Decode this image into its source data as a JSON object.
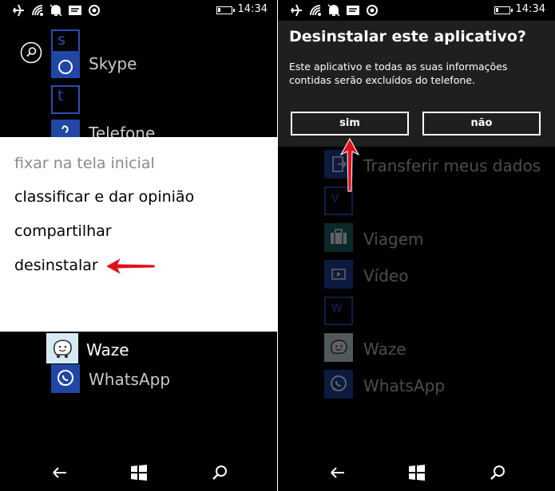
{
  "left_screen": {
    "status": {
      "time": "14:34"
    },
    "apps": {
      "s_letter": "s",
      "skype": "Skype",
      "t_letter": "t",
      "telefone": "Telefone",
      "waze": "Waze",
      "whatsapp": "WhatsApp"
    },
    "context_menu": {
      "items": [
        {
          "label": "fixar na tela inicial",
          "enabled": false
        },
        {
          "label": "classificar e dar opinião",
          "enabled": true
        },
        {
          "label": "compartilhar",
          "enabled": true
        },
        {
          "label": "desinstalar",
          "enabled": true
        }
      ]
    }
  },
  "right_screen": {
    "status": {
      "time": "14:34"
    },
    "dialog": {
      "title": "Desinstalar este aplicativo?",
      "message": "Este aplicativo e todas as suas informações contidas serão excluídos do telefone.",
      "yes_label": "sim",
      "no_label": "não"
    },
    "apps": {
      "transferir": "Transferir meus dados",
      "v_letter": "v",
      "viagem": "Viagem",
      "video": "Vídeo",
      "w_letter": "w",
      "waze": "Waze",
      "whatsapp": "WhatsApp"
    }
  },
  "colors": {
    "tile_blue": "#2146a6",
    "tile_teal": "#1f6a70",
    "letter_outline": "#2b4db5",
    "annotation_arrow": "#e0101a",
    "dialog_bg": "#1f1f1f"
  },
  "icons": [
    "airplane-icon",
    "wifi-icon",
    "quiet-hours-icon",
    "message-icon",
    "location-icon",
    "battery-icon",
    "search-icon",
    "back-icon",
    "windows-icon",
    "phone-icon",
    "skype-icon",
    "waze-icon",
    "whatsapp-icon",
    "transfer-icon",
    "suitcase-icon",
    "video-icon"
  ]
}
